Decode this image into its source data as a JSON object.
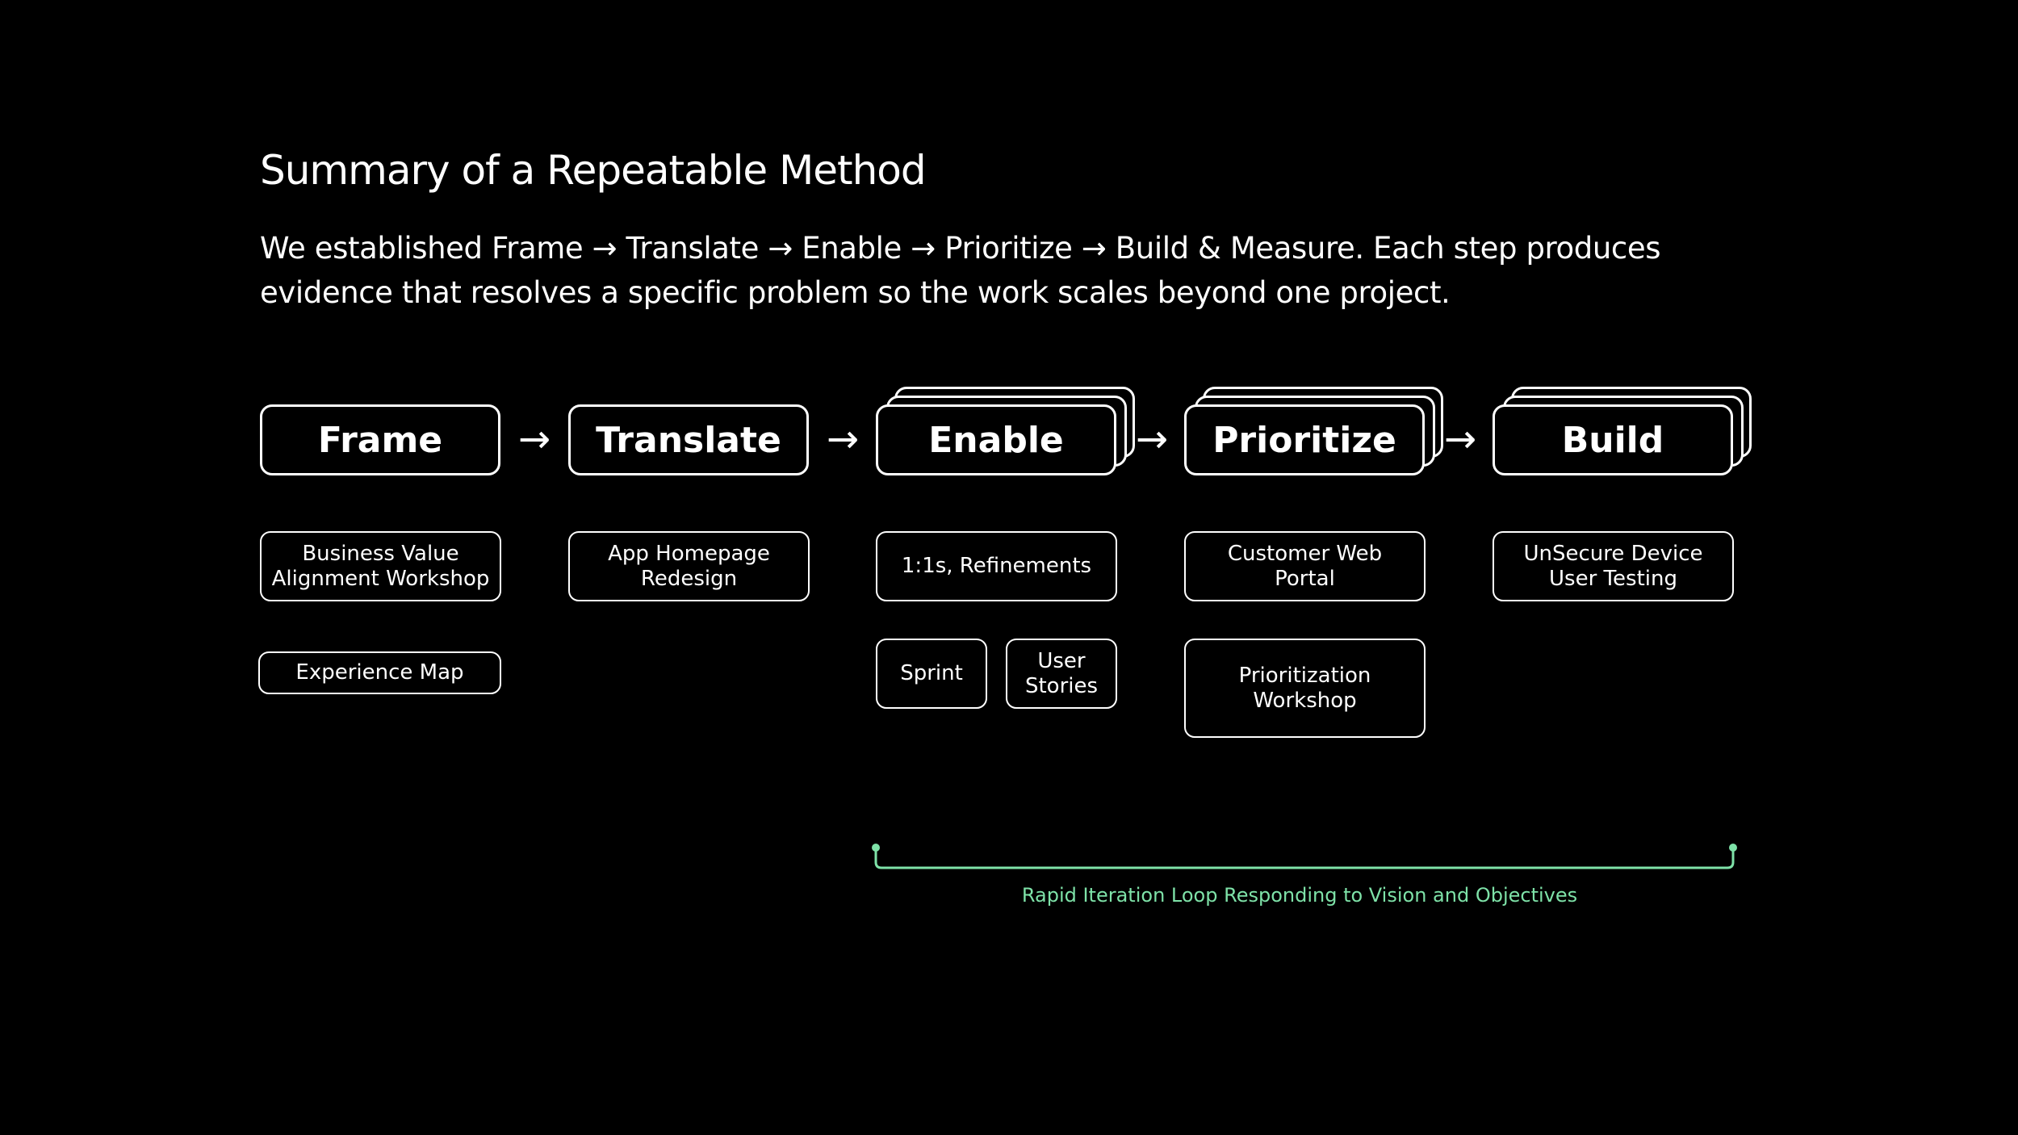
{
  "header": {
    "title": "Summary of a Repeatable Method",
    "subtitle": "We established Frame → Translate → Enable → Prioritize → Build & Measure. Each step produces evidence that resolves a specific problem so the work scales beyond one project."
  },
  "stages": [
    {
      "label": "Frame"
    },
    {
      "label": "Translate"
    },
    {
      "label": "Enable"
    },
    {
      "label": "Prioritize"
    },
    {
      "label": "Build"
    }
  ],
  "arrow_glyph": "→",
  "cards": {
    "frame": [
      "Business Value Alignment Workshop",
      "Experience Map"
    ],
    "translate": [
      "App Homepage Redesign"
    ],
    "enable": [
      "1:1s, Refinements",
      "Sprint",
      "User Stories"
    ],
    "prioritize": [
      "Customer Web Portal",
      "Prioritization Workshop"
    ],
    "build": [
      "UnSecure Device User Testing"
    ]
  },
  "loop": {
    "label": "Rapid Iteration Loop Responding to Vision and Objectives",
    "color": "#7ee2a8"
  },
  "colors": {
    "background": "#000000",
    "foreground": "#ffffff"
  }
}
